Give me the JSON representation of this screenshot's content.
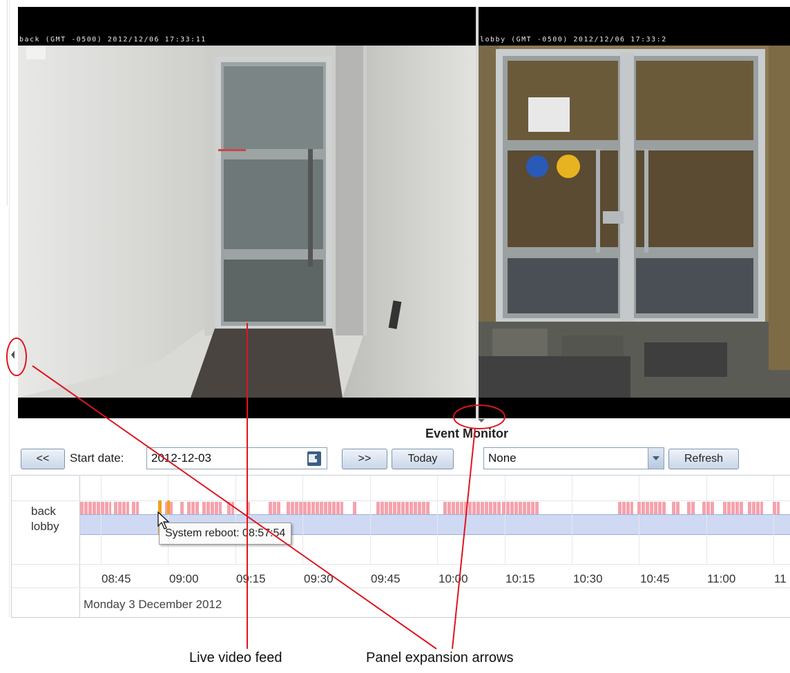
{
  "cameras": [
    {
      "caption": "back  (GMT -0500) 2012/12/06 17:33:11"
    },
    {
      "caption": "lobby (GMT -0500) 2012/12/06 17:33:2"
    }
  ],
  "event_monitor": {
    "title": "Event Monitor",
    "prev_label": "<<",
    "start_date_label": "Start date:",
    "start_date_value": "2012-12-03",
    "next_label": ">>",
    "today_label": "Today",
    "filter_value": "None",
    "refresh_label": "Refresh"
  },
  "timeline": {
    "rows": [
      "back",
      "lobby"
    ],
    "ticks": [
      "08:45",
      "09:00",
      "09:15",
      "09:30",
      "09:45",
      "10:00",
      "10:15",
      "10:30",
      "10:45",
      "11:00",
      "11"
    ],
    "day": "Monday 3 December 2012",
    "tooltip": "System reboot: 08:57:54"
  },
  "annotations": {
    "video_label": "Live video feed",
    "arrows_label": "Panel expansion arrows"
  },
  "colors": {
    "event": "#f5a3ad",
    "reboot": "#f0a223",
    "lobby_band": "#cfd9f3",
    "annotation": "#e0141e"
  }
}
